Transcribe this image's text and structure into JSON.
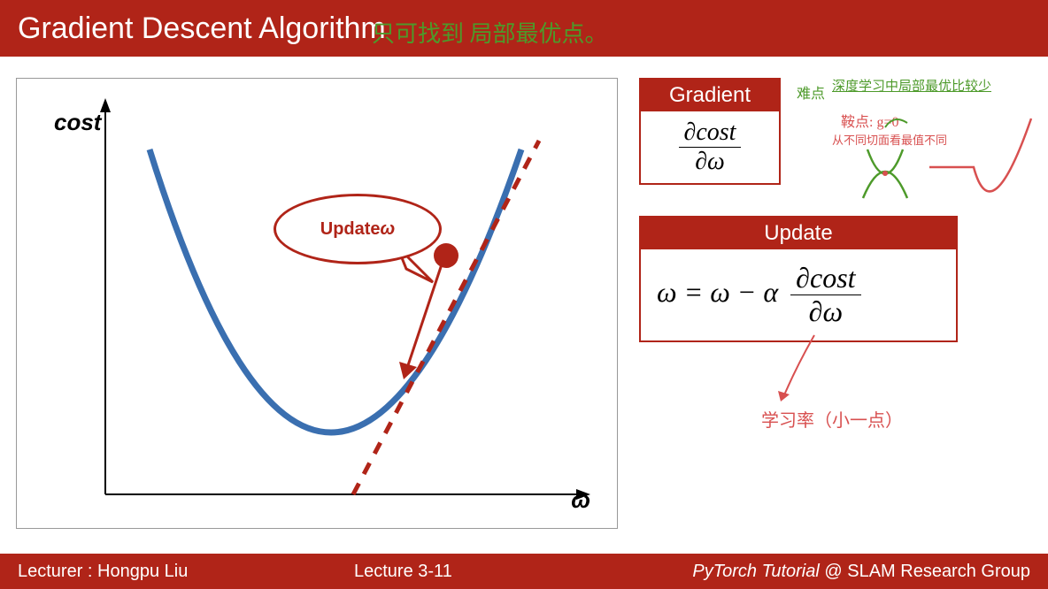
{
  "header": {
    "title": "Gradient Descent Algorithm",
    "annotation_green": "只可找到 局部最优点。"
  },
  "plot": {
    "ylabel": "cost",
    "xlabel": "ω",
    "speech_prefix": "Update ",
    "speech_var": "ω"
  },
  "gradient_card": {
    "title": "Gradient",
    "num": "∂cost",
    "den": "∂ω"
  },
  "update_card": {
    "title": "Update",
    "lhs": "ω = ω − α",
    "num": "∂cost",
    "den": "∂ω"
  },
  "annotations": {
    "top_right_green_1": "难点",
    "top_right_green_2": "深度学习中局部最优比较少",
    "saddle_red_1": "鞍点: g=0",
    "saddle_red_2": "从不同切面看最值不同",
    "lr_red": "学习率（小一点）"
  },
  "footer": {
    "lecturer": "Lecturer : Hongpu Liu",
    "lecture": "Lecture 3-11",
    "tutorial_italic": "PyTorch Tutorial",
    "tutorial_rest": " @ SLAM Research Group"
  }
}
